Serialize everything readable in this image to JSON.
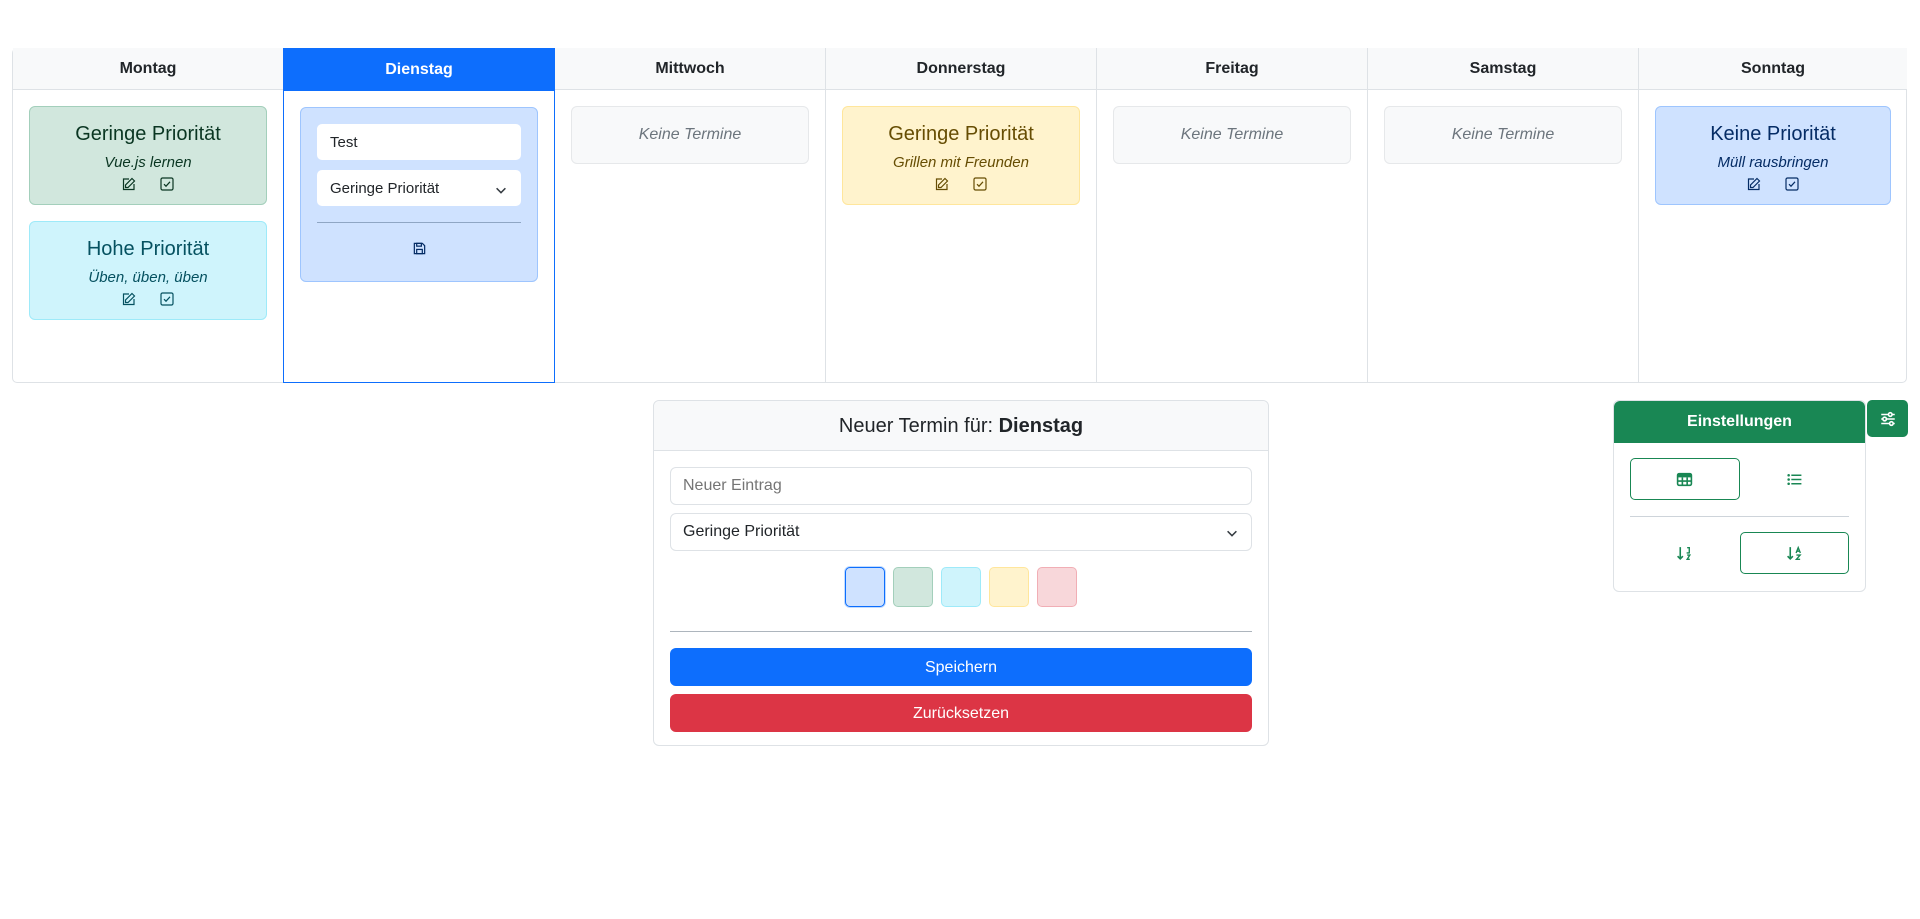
{
  "week": {
    "days": [
      {
        "name": "Montag"
      },
      {
        "name": "Dienstag"
      },
      {
        "name": "Mittwoch"
      },
      {
        "name": "Donnerstag"
      },
      {
        "name": "Freitag"
      },
      {
        "name": "Samstag"
      },
      {
        "name": "Sonntag"
      }
    ],
    "active_day": "Dienstag",
    "empty_label": "Keine Termine",
    "montag": [
      {
        "title": "Geringe Priorität",
        "text": "Vue.js lernen",
        "color": "#d1e7dd"
      },
      {
        "title": "Hohe Priorität",
        "text": "Üben, üben, üben",
        "color": "#cff4fc"
      }
    ],
    "dienstag_edit": {
      "input_value": "Test",
      "priority": "Geringe Priorität"
    },
    "donnerstag": [
      {
        "title": "Geringe Priorität",
        "text": "Grillen mit Freunden",
        "color": "#fff3cd"
      }
    ],
    "sonntag": [
      {
        "title": "Keine Priorität",
        "text": "Müll rausbringen",
        "color": "#cfe2ff"
      }
    ]
  },
  "form": {
    "title_prefix": "Neuer Termin für:",
    "title_day": "Dienstag",
    "input_placeholder": "Neuer Eintrag",
    "priority": "Geringe Priorität",
    "swatches": [
      "#cfe2ff",
      "#d1e7dd",
      "#cff4fc",
      "#fff3cd",
      "#f8d7da"
    ],
    "selected_swatch": 0,
    "save_label": "Speichern",
    "reset_label": "Zurücksetzen"
  },
  "settings": {
    "title": "Einstellungen",
    "view_buttons": [
      "table-icon",
      "list-icon"
    ],
    "sort_buttons": [
      "sort-numeric-down-icon",
      "sort-alpha-down-icon"
    ],
    "active_view": "table-icon",
    "active_sort": "sort-alpha-down-icon",
    "toggle_icon": "sliders-icon"
  },
  "colors": {
    "primary": "#0d6efd",
    "success": "#198754",
    "danger": "#dc3545"
  }
}
